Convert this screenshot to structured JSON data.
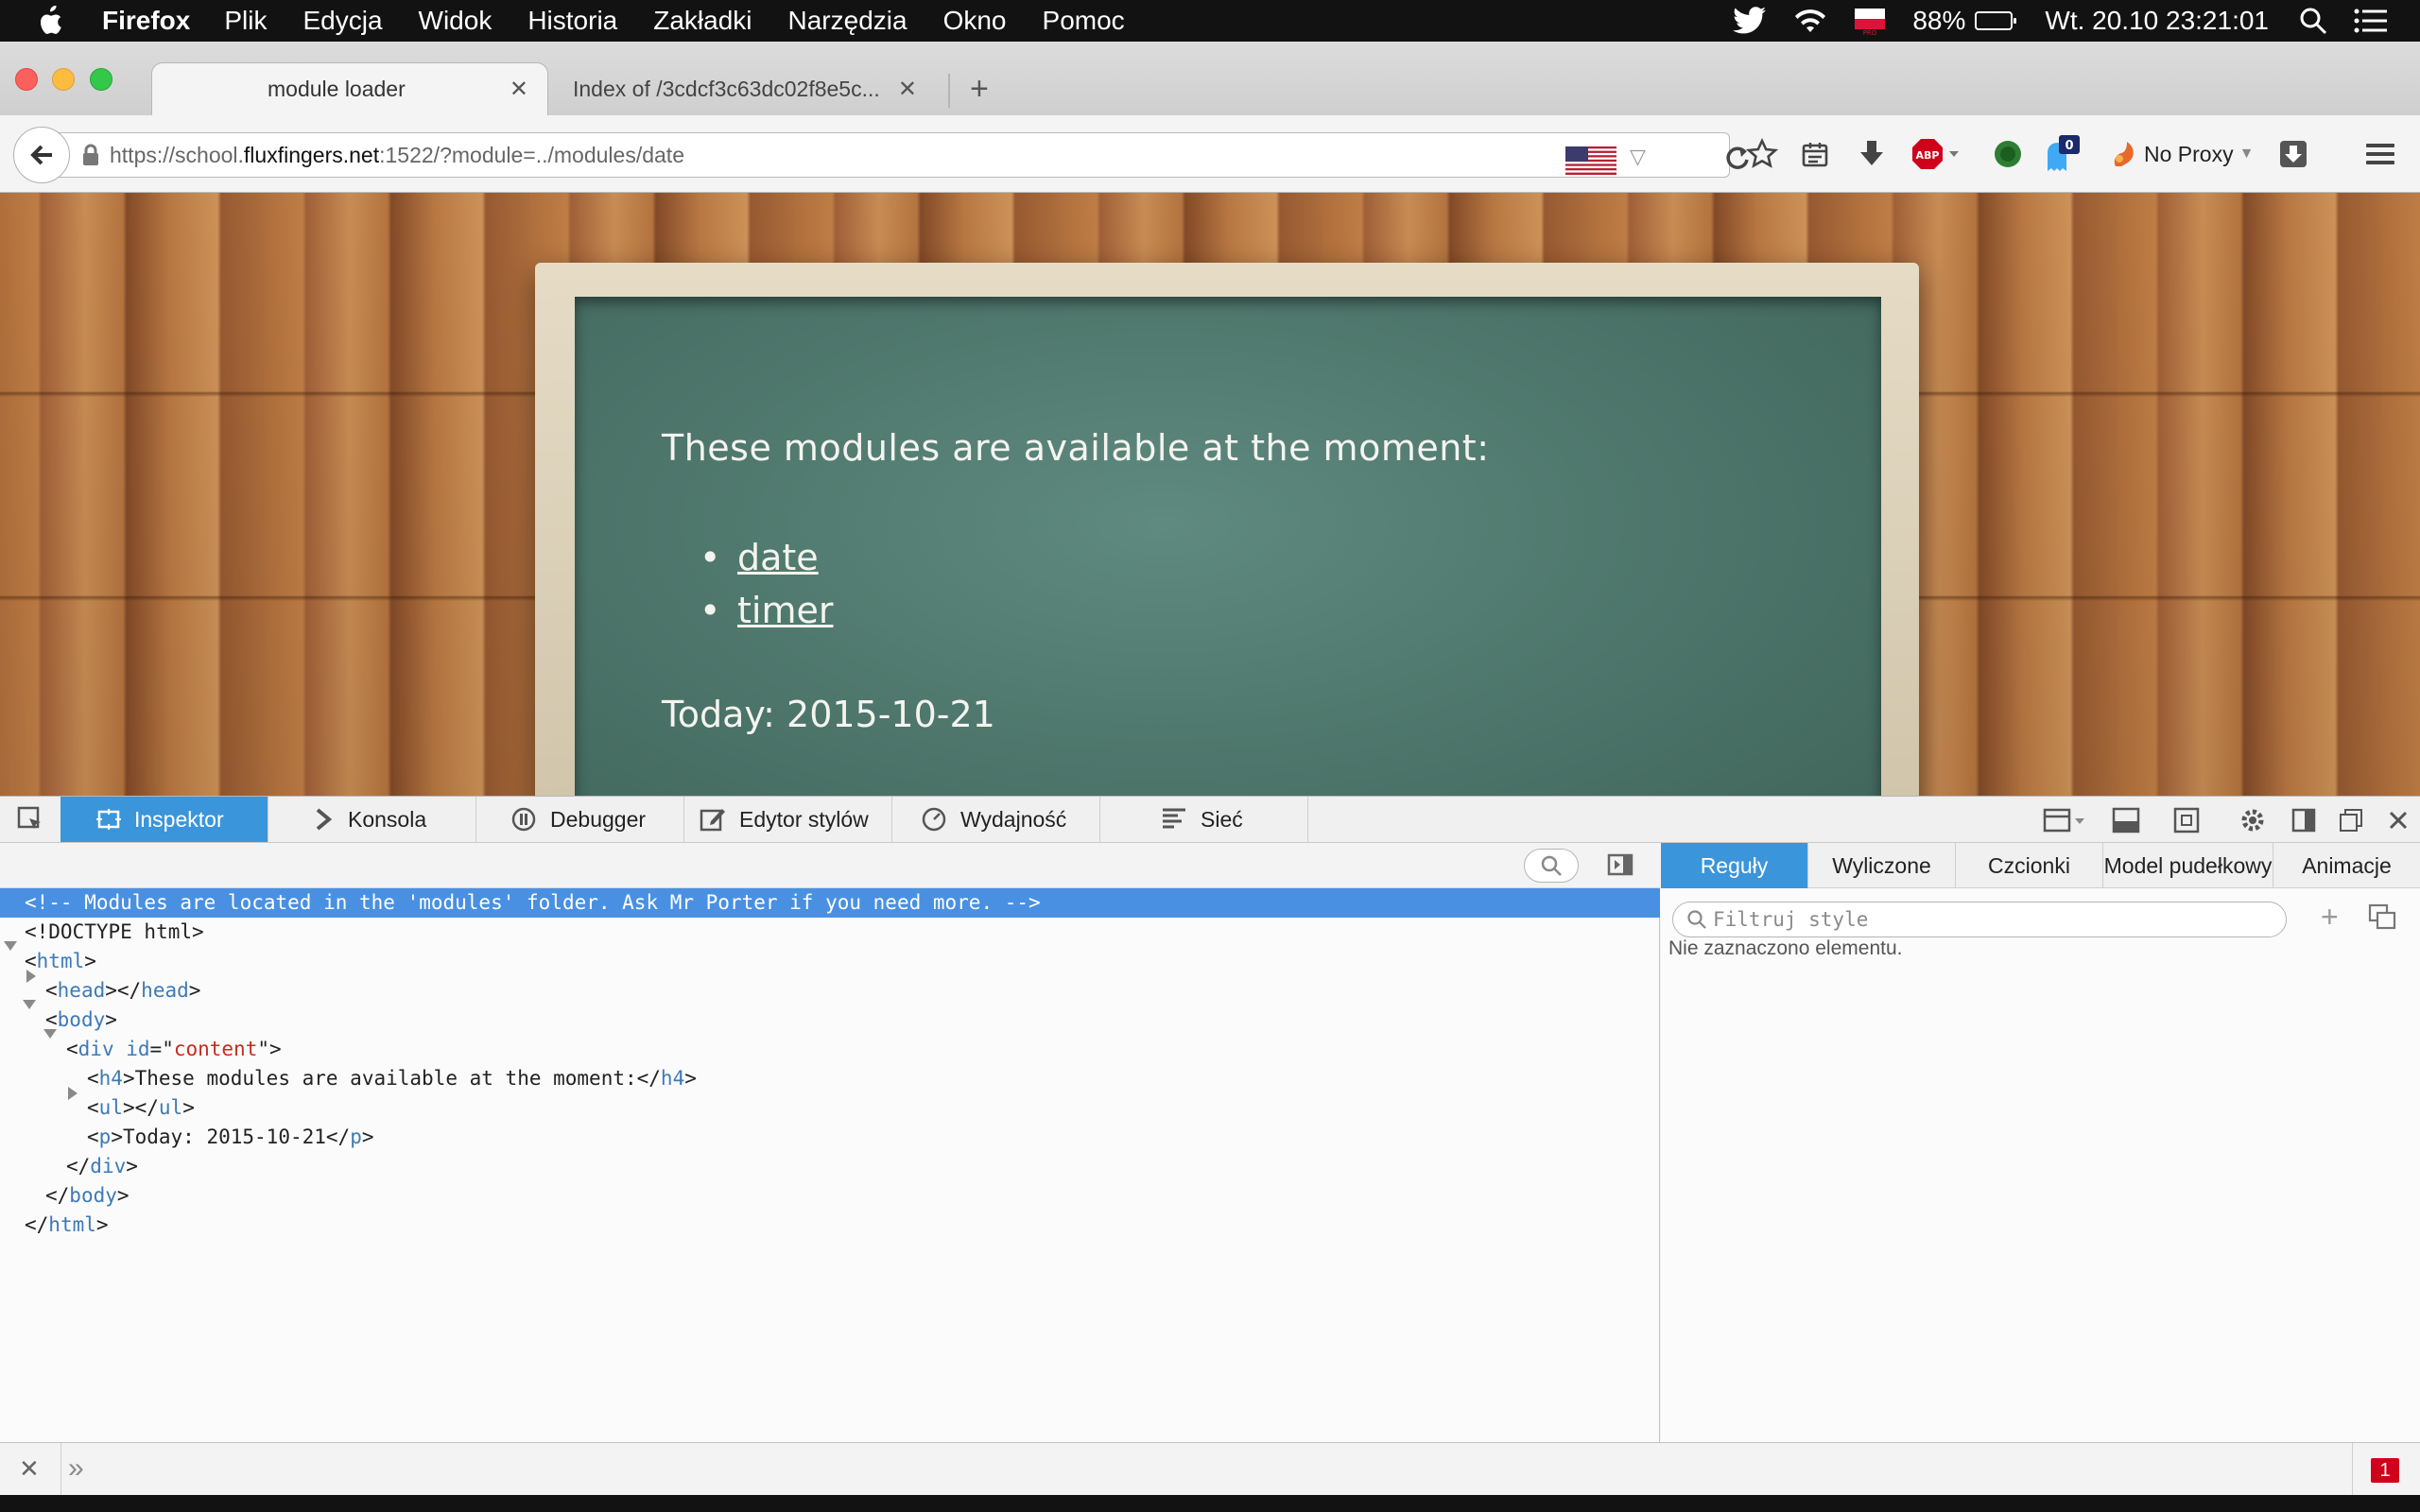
{
  "menubar": {
    "app_name": "Firefox",
    "items": [
      "Plik",
      "Edycja",
      "Widok",
      "Historia",
      "Zakładki",
      "Narzędzia",
      "Okno",
      "Pomoc"
    ],
    "battery": "88%",
    "battery_level": 0.88,
    "clock": "Wt. 20.10  23:21:01"
  },
  "tabs": {
    "active_title": "module loader",
    "inactive_title": "Index of /3cdcf3c63dc02f8e5c...",
    "close_glyph": "✕",
    "new_tab_glyph": "+"
  },
  "navbar": {
    "url_prefix": "https://school.",
    "url_domain": "fluxfingers.net",
    "url_suffix": ":1522/?module=../modules/date",
    "proxy_label": "No Proxy",
    "ghostery_count": "0"
  },
  "page": {
    "heading": "These modules are available at the moment:",
    "modules": [
      "date",
      "timer"
    ],
    "today": "Today: 2015-10-21"
  },
  "devtools": {
    "tabs": [
      "Inspektor",
      "Konsola",
      "Debugger",
      "Edytor stylów",
      "Wydajność",
      "Sieć"
    ],
    "markup": {
      "comment": "<!-- Modules are located in the 'modules' folder. Ask Mr Porter if you need more. -->",
      "doctype": "<!DOCTYPE html>",
      "html_tag": "html",
      "head_tag": "head",
      "body_tag": "body",
      "div_tag": "div",
      "div_attr": "id",
      "div_value": "content",
      "h4_tag": "h4",
      "h4_text": "These modules are available at the moment:",
      "ul_tag": "ul",
      "p_tag": "p",
      "p_text": "Today: 2015-10-21"
    },
    "rules_tabs": [
      "Reguły",
      "Wyliczone",
      "Czcionki",
      "Model pudełkowy",
      "Animacje"
    ],
    "filter_placeholder": "Filtruj style",
    "no_element": "Nie zaznaczono elementu.",
    "console_prompt": "»",
    "error_count": "1"
  },
  "colors": {
    "devtools_accent": "#3b95da",
    "chalkboard": "#4c7469",
    "selection": "#4a90e2"
  }
}
